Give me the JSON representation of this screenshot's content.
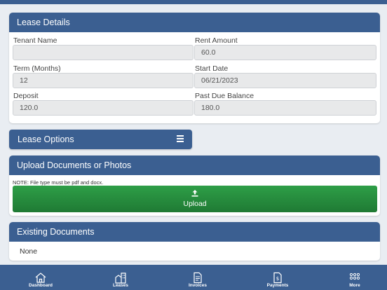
{
  "lease_details": {
    "title": "Lease Details",
    "fields": {
      "tenant_name": {
        "label": "Tenant Name",
        "value": ""
      },
      "rent_amount": {
        "label": "Rent Amount",
        "value": "60.0"
      },
      "term": {
        "label": "Term (Months)",
        "value": "12"
      },
      "start_date": {
        "label": "Start Date",
        "value": "06/21/2023"
      },
      "deposit": {
        "label": "Deposit",
        "value": "120.0"
      },
      "past_due": {
        "label": "Past Due Balance",
        "value": "180.0"
      }
    }
  },
  "lease_options": {
    "label": "Lease Options",
    "icon": "menu-icon"
  },
  "upload": {
    "title": "Upload Documents or Photos",
    "note": "NOTE: File type must be pdf and docx.",
    "button_label": "Upload",
    "button_icon": "upload-icon",
    "button_color": "#2b9143"
  },
  "existing_documents": {
    "title": "Existing Documents",
    "empty_text": "None"
  },
  "bottom_nav": {
    "items": [
      {
        "label": "Dashboard",
        "icon": "house-icon"
      },
      {
        "label": "Leases",
        "icon": "buildings-icon"
      },
      {
        "label": "Invoices",
        "icon": "document-icon"
      },
      {
        "label": "Payments",
        "icon": "dollar-document-icon"
      },
      {
        "label": "More",
        "icon": "grid-dots-icon"
      }
    ]
  },
  "colors": {
    "primary": "#3b5f91",
    "background": "#e9edf2",
    "success": "#2b9143"
  }
}
